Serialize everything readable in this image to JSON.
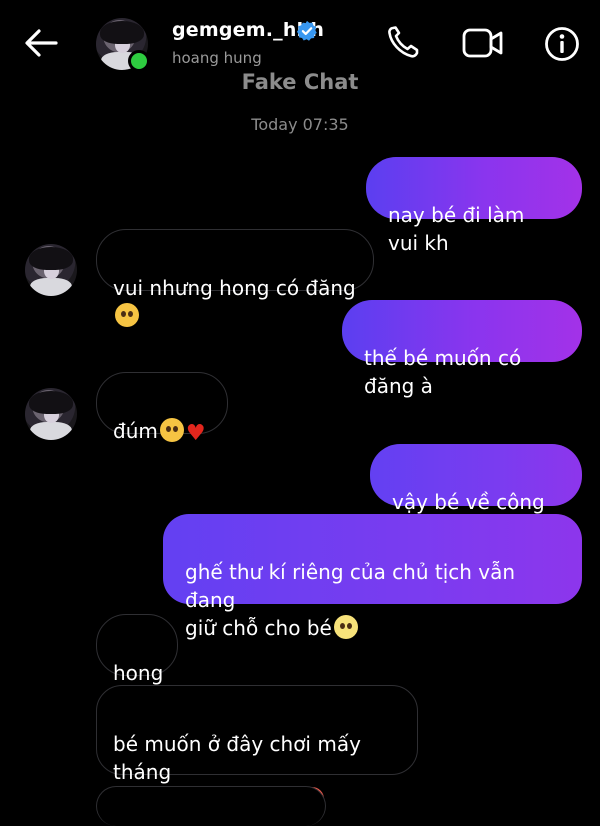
{
  "header": {
    "username": "gemgem._hhh",
    "subname": "hoang hung"
  },
  "watermark": "Fake Chat",
  "timestamp": "Today 07:35",
  "messages": [
    {
      "side": "sent",
      "text": "nay bé đi làm vui kh"
    },
    {
      "side": "received",
      "text": "vui nhưng hong có đăng",
      "emoji": "pleading-face-icon"
    },
    {
      "side": "sent",
      "text": "thế bé muốn có đăng à"
    },
    {
      "side": "received",
      "text": "đúm",
      "emoji": "crying-face-icon",
      "emoji2": "red-heart-icon"
    },
    {
      "side": "sent",
      "text": "vậy bé về công ty đi"
    },
    {
      "side": "sent",
      "text": "ghế thư kí riêng của chủ tịch vẫn đang\ngiữ chỗ cho bé",
      "emoji": "sun-face-icon"
    },
    {
      "side": "received",
      "text": "hong"
    },
    {
      "side": "received",
      "text": "bé muốn ở đây chơi mấy tháng\nvới anh em của bé",
      "emoji": "angry-face-icon"
    }
  ],
  "colors": {
    "background": "#000000",
    "sent_gradient_start": "#5b3ff0",
    "sent_gradient_end": "#a332e8",
    "received_border": "#2f2f33",
    "verified": "#3897f0",
    "online": "#2ecc40"
  }
}
